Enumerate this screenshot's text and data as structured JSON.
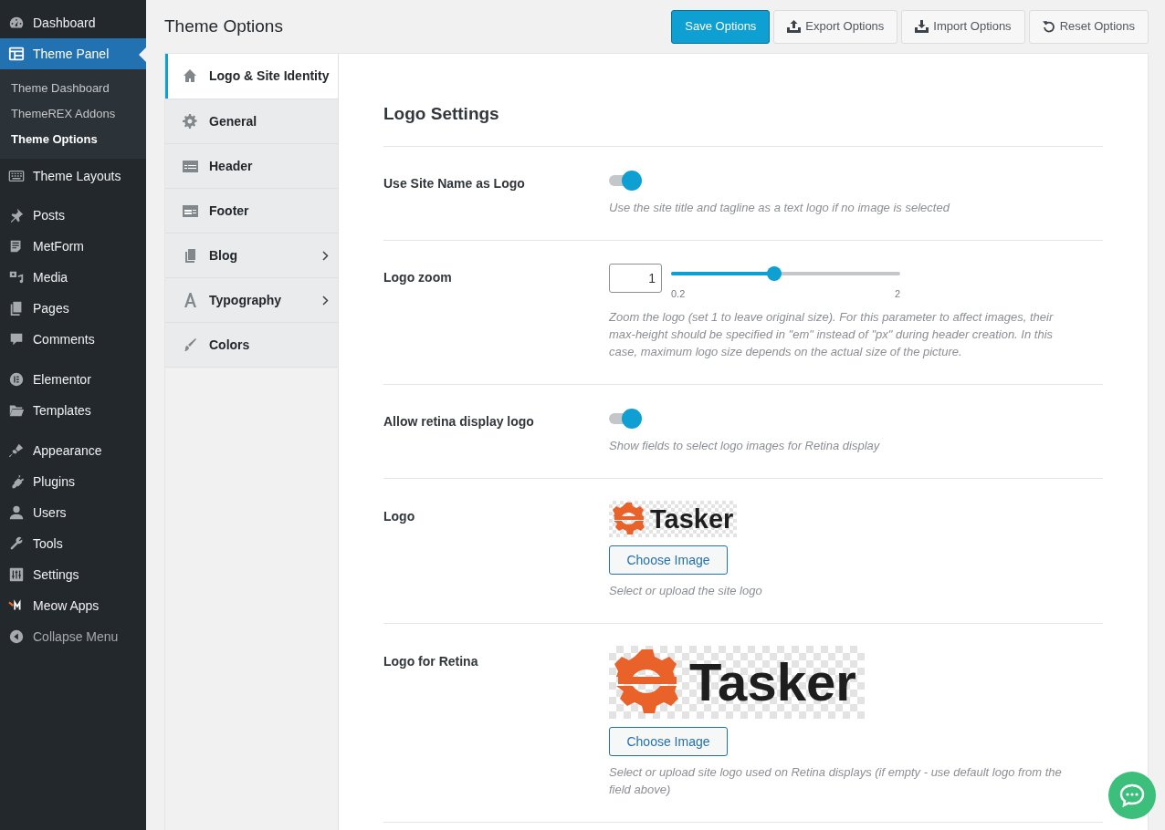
{
  "admin_menu": {
    "groups": [
      [
        {
          "label": "Dashboard",
          "selected": false
        },
        {
          "label": "Theme Panel",
          "selected": true,
          "children": [
            {
              "label": "Theme Dashboard",
              "selected": false
            },
            {
              "label": "ThemeREX Addons",
              "selected": false
            },
            {
              "label": "Theme Options",
              "selected": true
            }
          ]
        },
        {
          "label": "Theme Layouts",
          "selected": false
        }
      ],
      [
        {
          "label": "Posts",
          "selected": false
        },
        {
          "label": "MetForm",
          "selected": false
        },
        {
          "label": "Media",
          "selected": false
        },
        {
          "label": "Pages",
          "selected": false
        },
        {
          "label": "Comments",
          "selected": false
        }
      ],
      [
        {
          "label": "Elementor",
          "selected": false
        },
        {
          "label": "Templates",
          "selected": false
        }
      ],
      [
        {
          "label": "Appearance",
          "selected": false
        },
        {
          "label": "Plugins",
          "selected": false
        },
        {
          "label": "Users",
          "selected": false
        },
        {
          "label": "Tools",
          "selected": false
        },
        {
          "label": "Settings",
          "selected": false
        },
        {
          "label": "Meow Apps",
          "selected": false
        },
        {
          "label": "Collapse Menu",
          "selected": false,
          "kind": "collapse"
        }
      ]
    ]
  },
  "page_title": "Theme Options",
  "toolbar": [
    {
      "label": "Save Options",
      "kind": "primary"
    },
    {
      "label": "Export Options",
      "kind": "export"
    },
    {
      "label": "Import Options",
      "kind": "import"
    },
    {
      "label": "Reset Options",
      "kind": "reset"
    }
  ],
  "tabs": [
    {
      "label": "Logo & Site Identity",
      "selected": true,
      "has_submenu": false
    },
    {
      "label": "General",
      "selected": false,
      "has_submenu": false
    },
    {
      "label": "Header",
      "selected": false,
      "has_submenu": false
    },
    {
      "label": "Footer",
      "selected": false,
      "has_submenu": false
    },
    {
      "label": "Blog",
      "selected": false,
      "has_submenu": true
    },
    {
      "label": "Typography",
      "selected": false,
      "has_submenu": true
    },
    {
      "label": "Colors",
      "selected": false,
      "has_submenu": false
    }
  ],
  "section_title": "Logo Settings",
  "settings": [
    {
      "kind": "toggle",
      "label": "Use Site Name as Logo",
      "on": true,
      "description": "Use the site title and tagline as a text logo if no image is selected"
    },
    {
      "kind": "slider",
      "label": "Logo zoom",
      "value": "1",
      "min": "0.2",
      "max": "2",
      "level": 0.45,
      "description": "Zoom the logo (set 1 to leave original size). For this parameter to affect images, their max-height should be specified in \"em\" instead of \"px\" during header creation. In this case, maximum logo size depends on the actual size of the picture."
    },
    {
      "kind": "toggle",
      "label": "Allow retina display logo",
      "on": true,
      "description": "Show fields to select logo images for Retina display"
    },
    {
      "kind": "image",
      "label": "Logo",
      "logo_text": "Tasker",
      "button": "Choose Image",
      "description": "Select or upload the site logo"
    },
    {
      "kind": "large_image",
      "label": "Logo for Retina",
      "logo_text": "Tasker",
      "button": "Choose Image",
      "description": "Select or upload site logo used on Retina displays (if empty - use default logo from the field above)"
    }
  ]
}
